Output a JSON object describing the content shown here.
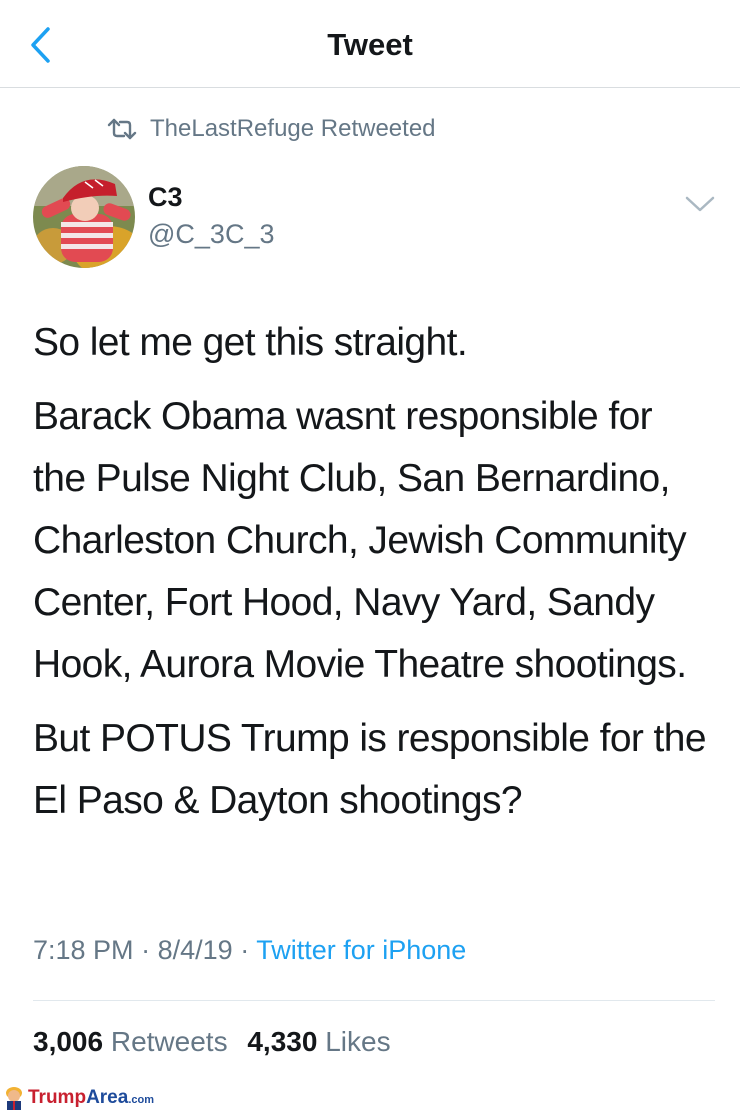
{
  "header": {
    "title": "Tweet",
    "back_icon": "chevron-left-icon",
    "accent_color": "#1da1f2"
  },
  "retweet_context": {
    "icon": "retweet-icon",
    "text": "TheLastRefuge Retweeted"
  },
  "author": {
    "display_name": "C3",
    "handle": "@C_3C_3",
    "avatar": "avatar-photo",
    "menu_icon": "chevron-down-icon"
  },
  "tweet": {
    "paragraphs": [
      "So let me get this straight.",
      "Barack Obama wasnt responsible for the Pulse Night Club, San Bernardino, Charleston Church, Jewish Community Center, Fort Hood, Navy Yard, Sandy Hook, Aurora Movie Theatre shootings.",
      "But POTUS Trump is responsible for the El Paso & Dayton shootings?"
    ]
  },
  "meta": {
    "time": "7:18 PM",
    "separator": "·",
    "date": "8/4/19",
    "source": "Twitter for iPhone"
  },
  "stats": {
    "retweets_count": "3,006",
    "retweets_label": "Retweets",
    "likes_count": "4,330",
    "likes_label": "Likes"
  },
  "watermark": {
    "part1": "Trump",
    "part2": "Area",
    "part3": ".com"
  }
}
